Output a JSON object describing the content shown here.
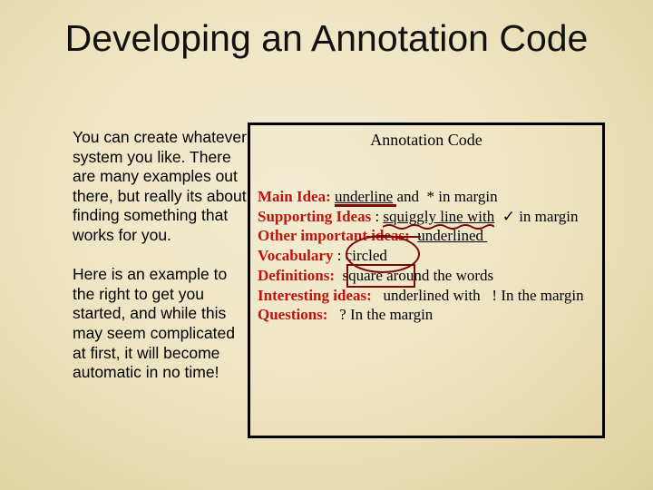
{
  "slide": {
    "title": "Developing an Annotation Code",
    "left_paragraphs": [
      "You can create whatever system you like. There are many examples out there, but really its about finding something that works for you.",
      "Here is an example to the right to get you started, and while this may seem complicated at first, it will become automatic in no time!"
    ],
    "box": {
      "title": "Annotation Code",
      "rows": [
        {
          "term": "Main Idea:",
          "parts": [
            "underline",
            " and  * in margin"
          ]
        },
        {
          "term": "Supporting Ideas",
          "parts": [
            " : ",
            "squiggly line with",
            "  ✓ in margin"
          ]
        },
        {
          "term": "Other important ideas:",
          "parts": [
            "  ",
            "underlined "
          ]
        },
        {
          "term": "Vocabulary",
          "parts": [
            " : circled"
          ]
        },
        {
          "term": "Definitions:",
          "parts": [
            "  square around the words"
          ]
        },
        {
          "term": "Interesting ideas:",
          "parts": [
            "   underlined with   ! In the margin"
          ]
        },
        {
          "term": "Questions:",
          "parts": [
            "   ? In the margin"
          ]
        }
      ]
    },
    "colors": {
      "term_red": "#c0120f",
      "mark_dark_red": "#7a0a08",
      "background": "#eee5c3"
    }
  }
}
